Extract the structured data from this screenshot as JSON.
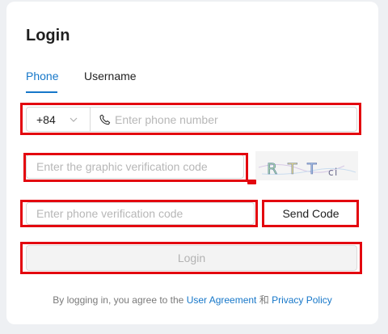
{
  "login": {
    "title": "Login",
    "tabs": [
      {
        "label": "Phone",
        "active": true
      },
      {
        "label": "Username",
        "active": false
      }
    ],
    "phone": {
      "country_code": "+84",
      "placeholder": "Enter phone number"
    },
    "graphic_code": {
      "placeholder": "Enter the graphic verification code",
      "captcha_text": "RTTci"
    },
    "verification": {
      "placeholder": "Enter phone verification code",
      "send_label": "Send Code"
    },
    "submit_label": "Login",
    "agreement": {
      "prefix": "By logging in, you agree to the ",
      "user_agreement": "User Agreement",
      "conjunction": " 和 ",
      "privacy_policy": "Privacy Policy"
    }
  },
  "colors": {
    "accent": "#1677c9",
    "highlight": "#e3060f",
    "placeholder": "#b7b7b7"
  },
  "icons": {
    "country_dropdown": "chevron-down-icon",
    "phone_field": "phone-icon"
  }
}
